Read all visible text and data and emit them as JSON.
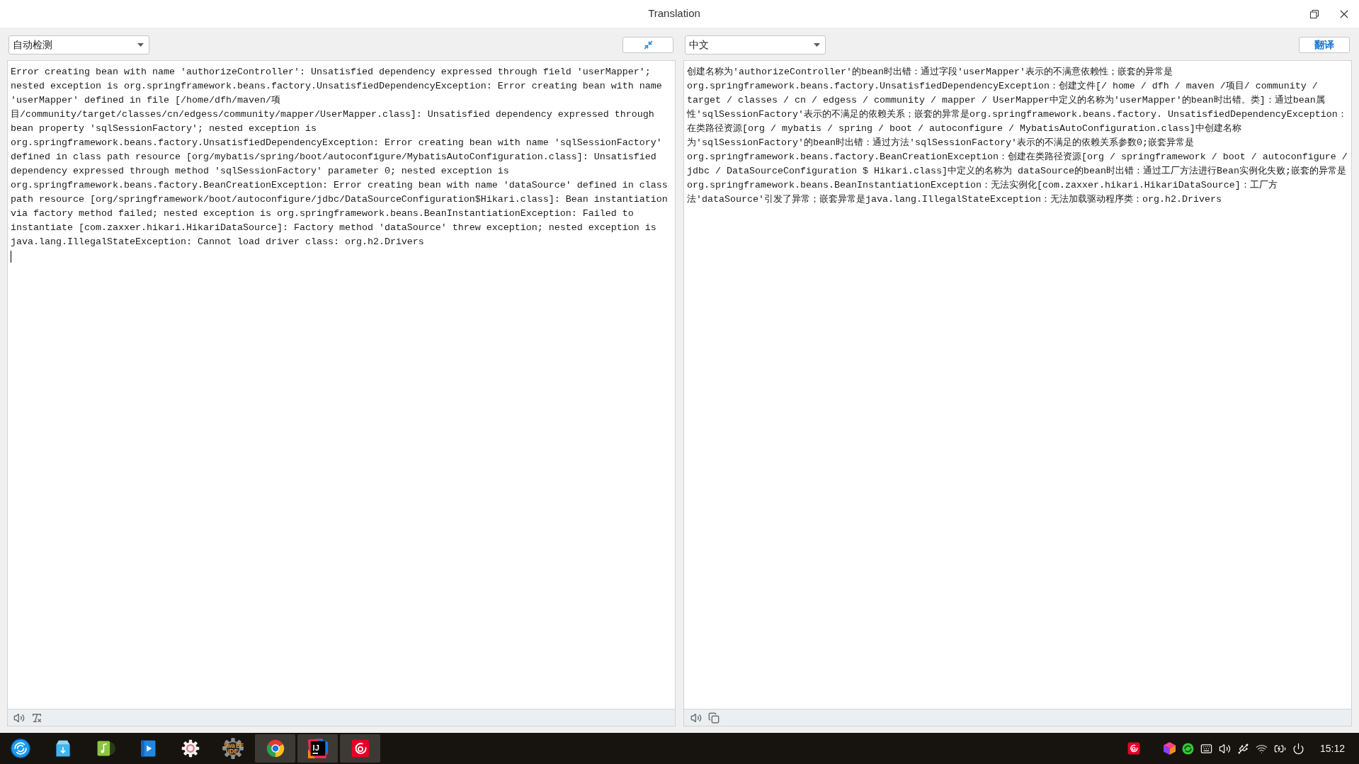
{
  "window": {
    "title": "Translation"
  },
  "toolbar": {
    "source_language": {
      "value": "自动检测"
    },
    "target_language": {
      "value": "中文"
    },
    "translate_button": {
      "label": "翻译"
    }
  },
  "source_panel": {
    "text": "Error creating bean with name 'authorizeController': Unsatisfied dependency expressed through field 'userMapper'; nested exception is org.springframework.beans.factory.UnsatisfiedDependencyException: Error creating bean with name 'userMapper' defined in file [/home/dfh/maven/项目/community/target/classes/cn/edgess/community/mapper/UserMapper.class]: Unsatisfied dependency expressed through bean property 'sqlSessionFactory'; nested exception is org.springframework.beans.factory.UnsatisfiedDependencyException: Error creating bean with name 'sqlSessionFactory' defined in class path resource [org/mybatis/spring/boot/autoconfigure/MybatisAutoConfiguration.class]: Unsatisfied dependency expressed through method 'sqlSessionFactory' parameter 0; nested exception is org.springframework.beans.factory.BeanCreationException: Error creating bean with name 'dataSource' defined in class path resource [org/springframework/boot/autoconfigure/jdbc/DataSourceConfiguration$Hikari.class]: Bean instantiation via factory method failed; nested exception is org.springframework.beans.BeanInstantiationException: Failed to instantiate [com.zaxxer.hikari.HikariDataSource]: Factory method 'dataSource' threw exception; nested exception is java.lang.IllegalStateException: Cannot load driver class: org.h2.Drivers",
    "focused": true
  },
  "target_panel": {
    "text": "创建名称为'authorizeController'的bean时出错：通过字段'userMapper'表示的不满意依赖性；嵌套的异常是org.springframework.beans.factory.UnsatisfiedDependencyException：创建文件[/ home / dfh / maven /项目/ community / target / classes / cn / edgess / community / mapper / UserMapper中定义的名称为'userMapper'的bean时出错。类]：通过bean属性'sqlSessionFactory'表示的不满足的依赖关系；嵌套的异常是org.springframework.beans.factory. UnsatisfiedDependencyException：在类路径资源[org / mybatis / spring / boot / autoconfigure / MybatisAutoConfiguration.class]中创建名称为'sqlSessionFactory'的bean时出错：通过方法'sqlSessionFactory'表示的不满足的依赖关系参数0;嵌套异常是org.springframework.beans.factory.BeanCreationException：创建在类路径资源[org / springframework / boot / autoconfigure / jdbc / DataSourceConfiguration $ Hikari.class]中定义的名称为 dataSource的bean时出错：通过工厂方法进行Bean实例化失败;嵌套的异常是org.springframework.beans.BeanInstantiationException：无法实例化[com.zaxxer.hikari.HikariDataSource]：工厂方法'dataSource'引发了异常；嵌套异常是java.lang.IllegalStateException：无法加载驱动程序类：org.h2.Drivers"
  },
  "taskbar": {
    "apps": [
      {
        "kind": "launcher",
        "running": false
      },
      {
        "kind": "store",
        "running": false
      },
      {
        "kind": "music",
        "running": false
      },
      {
        "kind": "video",
        "running": false
      },
      {
        "kind": "settings",
        "running": false
      },
      {
        "kind": "javaide",
        "running": false,
        "logo_lines": [
          "Java EE",
          "IDE"
        ]
      },
      {
        "kind": "browser",
        "running": true
      },
      {
        "kind": "ide",
        "running": true,
        "logo_text": "IJ"
      },
      {
        "kind": "cloudmusic",
        "running": true
      }
    ],
    "time": "15:12"
  }
}
